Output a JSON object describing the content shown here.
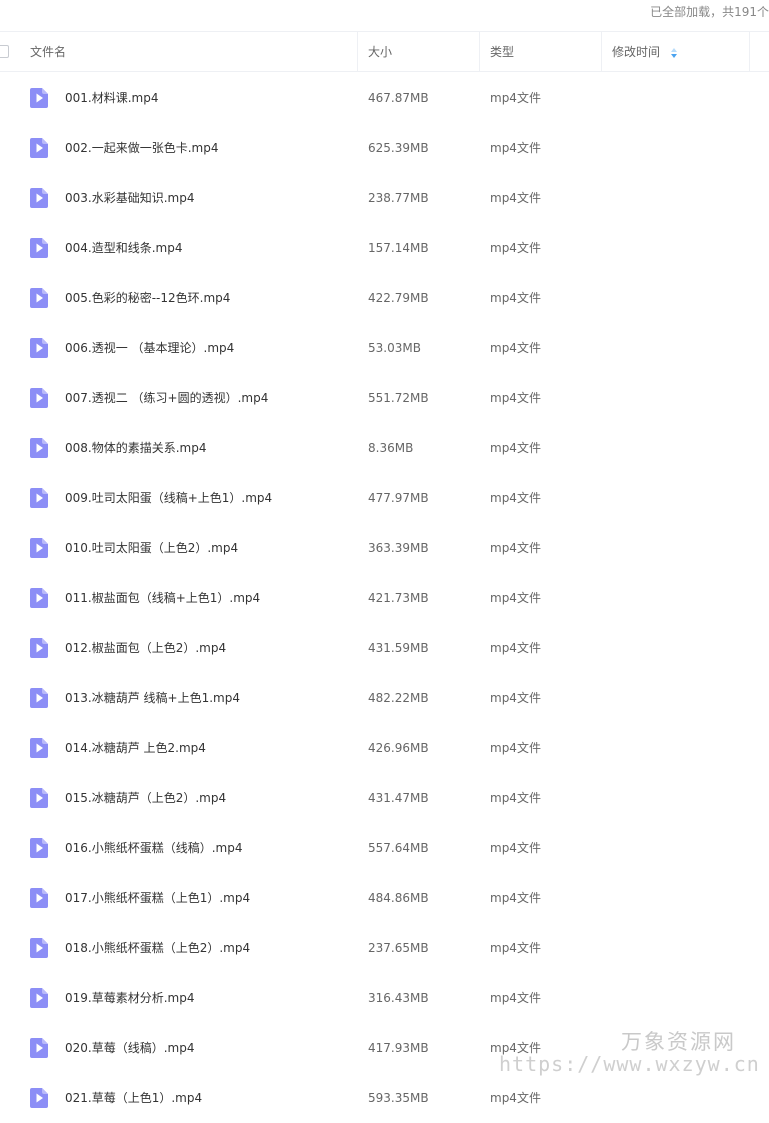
{
  "status": {
    "loaded_text": "已全部加载，共191个"
  },
  "header": {
    "name": "文件名",
    "size": "大小",
    "type": "类型",
    "modified": "修改时间"
  },
  "colors": {
    "file_icon": "#8c8ef6",
    "sort_arrow": "#4aa3f0"
  },
  "files": [
    {
      "name": "001.材料课.mp4",
      "size": "467.87MB",
      "type": "mp4文件"
    },
    {
      "name": "002.一起来做一张色卡.mp4",
      "size": "625.39MB",
      "type": "mp4文件"
    },
    {
      "name": "003.水彩基础知识.mp4",
      "size": "238.77MB",
      "type": "mp4文件"
    },
    {
      "name": "004.造型和线条.mp4",
      "size": "157.14MB",
      "type": "mp4文件"
    },
    {
      "name": "005.色彩的秘密--12色环.mp4",
      "size": "422.79MB",
      "type": "mp4文件"
    },
    {
      "name": "006.透视一 （基本理论）.mp4",
      "size": "53.03MB",
      "type": "mp4文件"
    },
    {
      "name": "007.透视二 （练习+圆的透视）.mp4",
      "size": "551.72MB",
      "type": "mp4文件"
    },
    {
      "name": "008.物体的素描关系.mp4",
      "size": "8.36MB",
      "type": "mp4文件"
    },
    {
      "name": "009.吐司太阳蛋（线稿+上色1）.mp4",
      "size": "477.97MB",
      "type": "mp4文件"
    },
    {
      "name": "010.吐司太阳蛋（上色2）.mp4",
      "size": "363.39MB",
      "type": "mp4文件"
    },
    {
      "name": "011.椒盐面包（线稿+上色1）.mp4",
      "size": "421.73MB",
      "type": "mp4文件"
    },
    {
      "name": "012.椒盐面包（上色2）.mp4",
      "size": "431.59MB",
      "type": "mp4文件"
    },
    {
      "name": "013.冰糖葫芦 线稿+上色1.mp4",
      "size": "482.22MB",
      "type": "mp4文件"
    },
    {
      "name": "014.冰糖葫芦 上色2.mp4",
      "size": "426.96MB",
      "type": "mp4文件"
    },
    {
      "name": "015.冰糖葫芦（上色2）.mp4",
      "size": "431.47MB",
      "type": "mp4文件"
    },
    {
      "name": "016.小熊纸杯蛋糕（线稿）.mp4",
      "size": "557.64MB",
      "type": "mp4文件"
    },
    {
      "name": "017.小熊纸杯蛋糕（上色1）.mp4",
      "size": "484.86MB",
      "type": "mp4文件"
    },
    {
      "name": "018.小熊纸杯蛋糕（上色2）.mp4",
      "size": "237.65MB",
      "type": "mp4文件"
    },
    {
      "name": "019.草莓素材分析.mp4",
      "size": "316.43MB",
      "type": "mp4文件"
    },
    {
      "name": "020.草莓（线稿）.mp4",
      "size": "417.93MB",
      "type": "mp4文件"
    },
    {
      "name": "021.草莓（上色1）.mp4",
      "size": "593.35MB",
      "type": "mp4文件"
    }
  ],
  "watermark": {
    "title": "万象资源网",
    "url": "https://www.wxzyw.cn"
  }
}
